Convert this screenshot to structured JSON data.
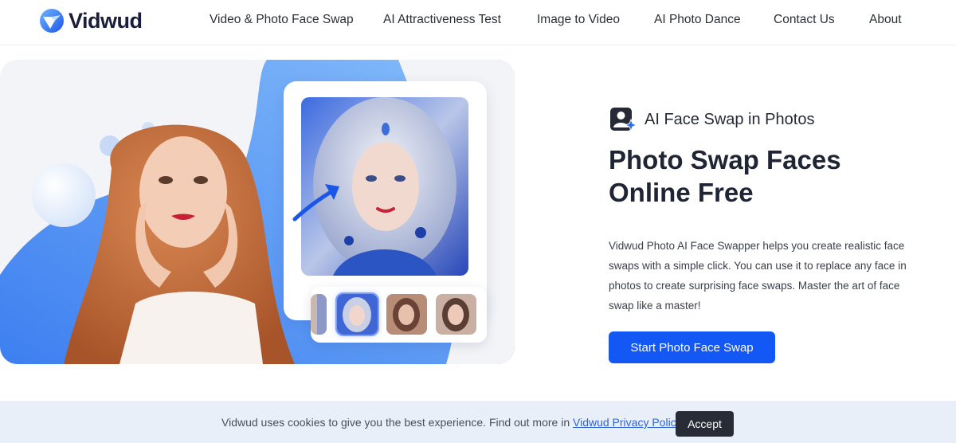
{
  "header": {
    "logo_text": "Vidwud",
    "nav": [
      {
        "label": "Video & Photo Face Swap",
        "name": "nav-video-photo-face-swap"
      },
      {
        "label": "AI Attractiveness Test",
        "name": "nav-ai-attractiveness-test"
      },
      {
        "label": "Image to Video",
        "name": "nav-image-to-video"
      },
      {
        "label": "AI Photo Dance",
        "name": "nav-ai-photo-dance"
      },
      {
        "label": "Contact Us",
        "name": "nav-contact-us"
      },
      {
        "label": "About",
        "name": "nav-about"
      }
    ]
  },
  "hero": {
    "feature_icon": "user-sparkle-icon",
    "feature_label": "AI Face Swap in Photos",
    "headline_line1": "Photo Swap Faces",
    "headline_line2": "Online Free",
    "description": "Vidwud Photo AI Face Swapper helps you create realistic face swaps with a simple click. You can use it to replace any face in photos to create surprising face swaps. Master the art of face swap like a master!",
    "cta_label": "Start Photo Face Swap"
  },
  "cookie": {
    "text": "Vidwud uses cookies to give you the best experience. Find out more in ",
    "link_text": "Vidwud Privacy Policy",
    "suffix": ".",
    "accept_label": "Accept"
  },
  "colors": {
    "brand_blue": "#1357f5",
    "accent_light_blue": "#5a9df5",
    "dark": "#1f2535",
    "cookie_bg": "#e9eff9"
  }
}
